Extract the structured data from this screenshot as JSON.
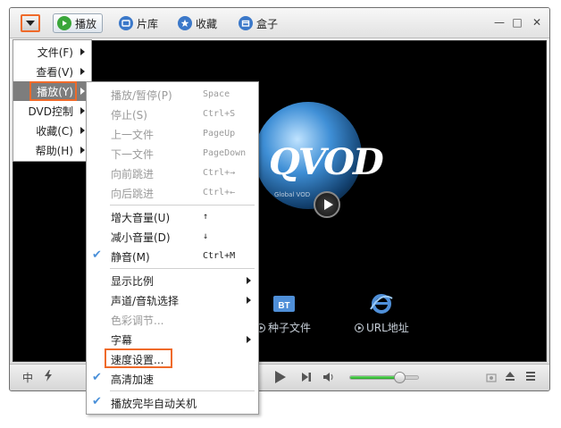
{
  "toolbar": {
    "tabs": [
      {
        "label": "播放",
        "icon": "play-circle-icon",
        "color": "#3aa63a"
      },
      {
        "label": "片库",
        "icon": "film-library-icon",
        "color": "#3b78c9"
      },
      {
        "label": "收藏",
        "icon": "star-icon",
        "color": "#3b78c9"
      },
      {
        "label": "盒子",
        "icon": "box-icon",
        "color": "#3b78c9"
      }
    ],
    "window_controls": [
      "—",
      "□",
      "✕"
    ]
  },
  "main_menu": {
    "items": [
      {
        "label": "文件(F)"
      },
      {
        "label": "查看(V)"
      },
      {
        "label": "播放(Y)",
        "active": true
      },
      {
        "label": "DVD控制"
      },
      {
        "label": "收藏(C)"
      },
      {
        "label": "帮助(H)"
      }
    ]
  },
  "play_submenu": {
    "items": [
      {
        "label": "播放/暂停(P)",
        "shortcut": "Space",
        "disabled": true
      },
      {
        "label": "停止(S)",
        "shortcut": "Ctrl+S",
        "disabled": true
      },
      {
        "label": "上一文件",
        "shortcut": "PageUp",
        "disabled": true
      },
      {
        "label": "下一文件",
        "shortcut": "PageDown",
        "disabled": true
      },
      {
        "label": "向前跳进",
        "shortcut": "Ctrl+→",
        "disabled": true
      },
      {
        "label": "向后跳进",
        "shortcut": "Ctrl+←",
        "disabled": true
      },
      {
        "label": "增大音量(U)",
        "shortcut": "↑"
      },
      {
        "label": "减小音量(D)",
        "shortcut": "↓"
      },
      {
        "label": "静音(M)",
        "shortcut": "Ctrl+M",
        "checked": true
      },
      {
        "label": "显示比例",
        "submenu": true
      },
      {
        "label": "声道/音轨选择",
        "submenu": true
      },
      {
        "label": "色彩调节...",
        "disabled": true
      },
      {
        "label": "字幕",
        "submenu": true
      },
      {
        "label": "速度设置...",
        "highlighted": true
      },
      {
        "label": "高清加速",
        "checked": true
      },
      {
        "label": "播放完毕自动关机",
        "checked": true
      }
    ]
  },
  "video": {
    "logo_text": "QVOD",
    "logo_subtitle": "Global VOD",
    "quick_links": [
      {
        "label": "种子文件",
        "icon": "bt-icon"
      },
      {
        "label": "URL地址",
        "icon": "ie-icon"
      }
    ]
  },
  "controlbar": {
    "left_label": "中",
    "volume_level": 0.72
  },
  "colors": {
    "highlight_outline": "#ef6a2a",
    "menu_active_bg": "#7d7d7d",
    "check_color": "#4a90d9"
  }
}
